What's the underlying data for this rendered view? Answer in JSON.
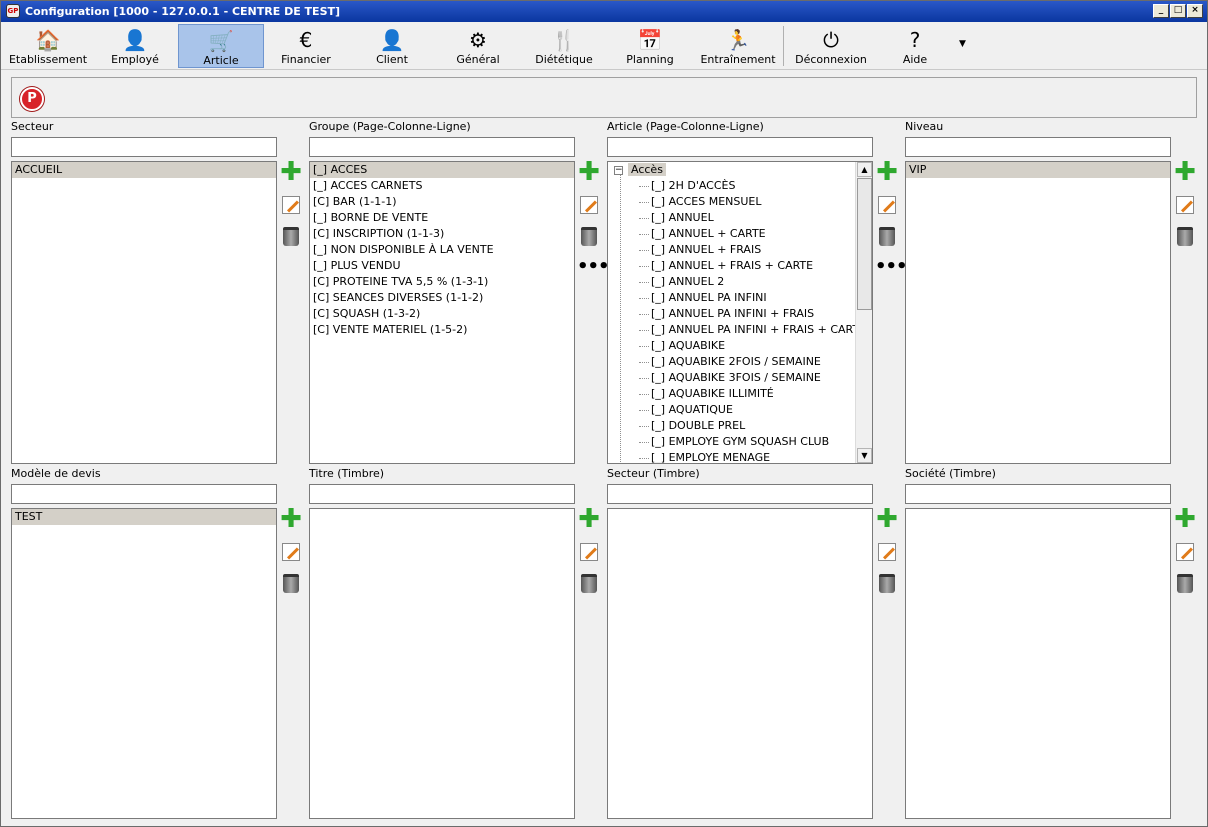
{
  "window": {
    "title": "Configuration [1000 - 127.0.0.1 - CENTRE DE TEST]",
    "app_icon_text": "GP",
    "controls": [
      "_",
      "□",
      "×"
    ]
  },
  "toolbar": {
    "items": [
      {
        "label": "Etablissement",
        "icon": "house-icon",
        "glyph": "🏠"
      },
      {
        "label": "Employé",
        "icon": "employee-stamp-icon",
        "glyph": "👤"
      },
      {
        "label": "Article",
        "icon": "cart-icon",
        "glyph": "🛒"
      },
      {
        "label": "Financier",
        "icon": "euro-icon",
        "glyph": "€"
      },
      {
        "label": "Client",
        "icon": "client-person-icon",
        "glyph": "👤"
      },
      {
        "label": "Général",
        "icon": "gear-icon",
        "glyph": "⚙"
      },
      {
        "label": "Diététique",
        "icon": "cutlery-icon",
        "glyph": "🍴"
      },
      {
        "label": "Planning",
        "icon": "calendar-icon",
        "glyph": "📅"
      },
      {
        "label": "Entraînement",
        "icon": "runner-icon",
        "glyph": "🏃"
      },
      {
        "label": "Déconnexion",
        "icon": "power-icon",
        "glyph": "⏻"
      },
      {
        "label": "Aide",
        "icon": "help-icon",
        "glyph": "?"
      }
    ],
    "selected": "Article",
    "overflow_glyph": "▼"
  },
  "subbar": {
    "p_button": "P"
  },
  "panels": {
    "secteur": {
      "label": "Secteur",
      "items": [
        "ACCUEIL"
      ]
    },
    "groupe": {
      "label": "Groupe (Page-Colonne-Ligne)",
      "items": [
        "[_] ACCES",
        "[_] ACCES CARNETS",
        "[C] BAR (1-1-1)",
        "[_] BORNE DE VENTE",
        "[C] INSCRIPTION (1-1-3)",
        "[_] NON DISPONIBLE À LA VENTE",
        "[_] PLUS VENDU",
        "[C] PROTEINE TVA 5,5 % (1-3-1)",
        "[C] SEANCES DIVERSES (1-1-2)",
        "[C] SQUASH (1-3-2)",
        "[C] VENTE MATERIEL (1-5-2)"
      ]
    },
    "article": {
      "label": "Article (Page-Colonne-Ligne)",
      "root": "Accès",
      "items": [
        "[_] 2H D'ACCÈS",
        "[_] ACCES MENSUEL",
        "[_] ANNUEL",
        "[_] ANNUEL + CARTE",
        "[_] ANNUEL + FRAIS",
        "[_] ANNUEL + FRAIS + CARTE",
        "[_] ANNUEL 2",
        "[_] ANNUEL PA INFINI",
        "[_] ANNUEL PA INFINI + FRAIS",
        "[_] ANNUEL PA INFINI + FRAIS + CARTE",
        "[_] AQUABIKE",
        "[_] AQUABIKE 2FOIS / SEMAINE",
        "[_] AQUABIKE 3FOIS / SEMAINE",
        "[_] AQUABIKE ILLIMITÉ",
        "[_] AQUATIQUE",
        "[_] DOUBLE PREL",
        "[_] EMPLOYE GYM SQUASH CLUB",
        "[_] EMPLOYE MENAGE"
      ]
    },
    "niveau": {
      "label": "Niveau",
      "items": [
        "VIP"
      ]
    },
    "modele": {
      "label": "Modèle de devis",
      "items": [
        "TEST"
      ]
    },
    "titre": {
      "label": "Titre (Timbre)",
      "items": []
    },
    "secteur_timbre": {
      "label": "Secteur (Timbre)",
      "items": []
    },
    "societe": {
      "label": "Société (Timbre)",
      "items": []
    }
  },
  "icons": {
    "add": "add-plus-icon",
    "edit": "edit-icon",
    "delete": "trash-icon",
    "more": "more-dots-icon",
    "more_glyph": "•••",
    "add_glyph": "✚",
    "scroll_up": "▲",
    "scroll_down": "▼",
    "tree_collapse": "−"
  }
}
